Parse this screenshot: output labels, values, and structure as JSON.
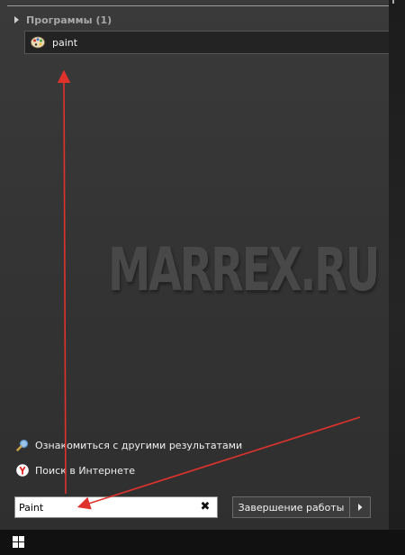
{
  "programs_section": {
    "header": "Программы (1)",
    "items": [
      {
        "label": "paint",
        "icon": "paint-palette-icon"
      }
    ]
  },
  "watermark": "MARREX.RU",
  "more_results": {
    "label": "Ознакомиться с другими результатами",
    "icon": "magnifier-icon"
  },
  "internet_search": {
    "label": "Поиск в Интернете",
    "icon": "yandex-icon"
  },
  "search": {
    "value": "Paint",
    "clear_icon": "close-icon"
  },
  "shutdown": {
    "label": "Завершение работы",
    "arrow_icon": "chevron-right-icon"
  },
  "taskbar": {
    "start_icon": "windows-logo-icon"
  },
  "colors": {
    "annotation_arrow": "#e0322c",
    "panel_background": "#363636",
    "taskbar": "#111111",
    "yandex": "#e52620"
  }
}
